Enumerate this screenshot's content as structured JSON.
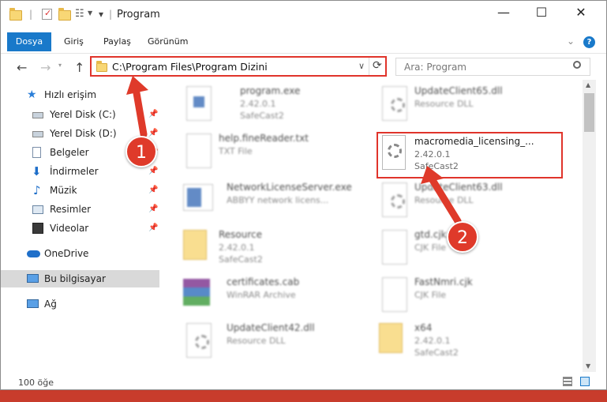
{
  "window": {
    "title": "Program",
    "minimize": "—",
    "maximize": "☐",
    "close": "✕"
  },
  "ribbon": {
    "tabs": [
      "Dosya",
      "Giriş",
      "Paylaş",
      "Görünüm"
    ],
    "expand": "⌄",
    "help": "?"
  },
  "nav": {
    "back": "←",
    "forward": "→",
    "up": "↑",
    "dropdown": "∨",
    "refresh": "⟳"
  },
  "address": {
    "path": "C:\\Program Files\\Program Dizini"
  },
  "search": {
    "placeholder": "Ara: Program"
  },
  "sidebar": {
    "items": [
      {
        "label": "Hızlı erişim"
      },
      {
        "label": "Yerel Disk (C:)"
      },
      {
        "label": "Yerel Disk (D:)"
      },
      {
        "label": "Belgeler"
      },
      {
        "label": "İndirmeler"
      },
      {
        "label": "Müzik"
      },
      {
        "label": "Resimler"
      },
      {
        "label": "Videolar"
      },
      {
        "label": "OneDrive"
      },
      {
        "label": "Bu bilgisayar"
      },
      {
        "label": "Ağ"
      }
    ]
  },
  "files": [
    {
      "name": "program.exe",
      "line2": "2.42.0.1",
      "line3": "SafeCast2"
    },
    {
      "name": "UpdateClient65.dll",
      "line2": "Resource DLL",
      "line3": ""
    },
    {
      "name": "help.fineReader.txt",
      "line2": "TXT File",
      "line3": ""
    },
    {
      "name": "macromedia_licensing_...",
      "line2": "2.42.0.1",
      "line3": "SafeCast2"
    },
    {
      "name": "NetworkLicenseServer.exe",
      "line2": "ABBYY network licens...",
      "line3": ""
    },
    {
      "name": "UpdateClient63.dll",
      "line2": "Resource DLL",
      "line3": ""
    },
    {
      "name": "Resource",
      "line2": "2.42.0.1",
      "line3": "SafeCast2"
    },
    {
      "name": "gtd.cjk",
      "line2": "CJK File",
      "line3": ""
    },
    {
      "name": "certificates.cab",
      "line2": "WinRAR Archive",
      "line3": ""
    },
    {
      "name": "FastNmri.cjk",
      "line2": "CJK File",
      "line3": ""
    },
    {
      "name": "UpdateClient42.dll",
      "line2": "Resource DLL",
      "line3": ""
    },
    {
      "name": "x64",
      "line2": "2.42.0.1",
      "line3": "SafeCast2"
    }
  ],
  "status": {
    "count": "100 öğe"
  },
  "callouts": {
    "one": "1",
    "two": "2"
  },
  "colors": {
    "accent": "#1979ca",
    "highlight": "#e0342b"
  }
}
